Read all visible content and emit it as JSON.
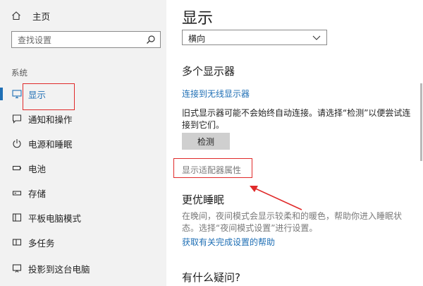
{
  "sidebar": {
    "home_label": "主页",
    "search_placeholder": "查找设置",
    "section_label": "系统",
    "items": [
      {
        "label": "显示",
        "icon": "monitor-icon",
        "active": true
      },
      {
        "label": "通知和操作",
        "icon": "notification-icon"
      },
      {
        "label": "电源和睡眠",
        "icon": "power-icon"
      },
      {
        "label": "电池",
        "icon": "battery-icon"
      },
      {
        "label": "存储",
        "icon": "storage-icon"
      },
      {
        "label": "平板电脑模式",
        "icon": "tablet-mode-icon"
      },
      {
        "label": "多任务",
        "icon": "multitask-icon"
      },
      {
        "label": "投影到这台电脑",
        "icon": "project-icon"
      }
    ]
  },
  "main": {
    "title": "显示",
    "orientation_value": "横向",
    "multi_display_heading": "多个显示器",
    "wireless_link": "连接到无线显示器",
    "detect_text": "旧式显示器可能不会始终自动连接。请选择“检测”以便尝试连接到它们。",
    "detect_button": "检测",
    "adapter_properties": "显示适配器属性",
    "sleep_heading": "更优睡眠",
    "sleep_text": "在晚间，夜间模式会显示较柔和的暖色，帮助你进入睡眠状态。选择“夜间模式设置”进行设置。",
    "help_link": "获取有关完成设置的帮助",
    "question_heading": "有什么疑问?"
  },
  "colors": {
    "accent": "#1f6fb5",
    "annotation_red": "#e02a2a",
    "sidebar_bg": "#f2f2f2"
  }
}
